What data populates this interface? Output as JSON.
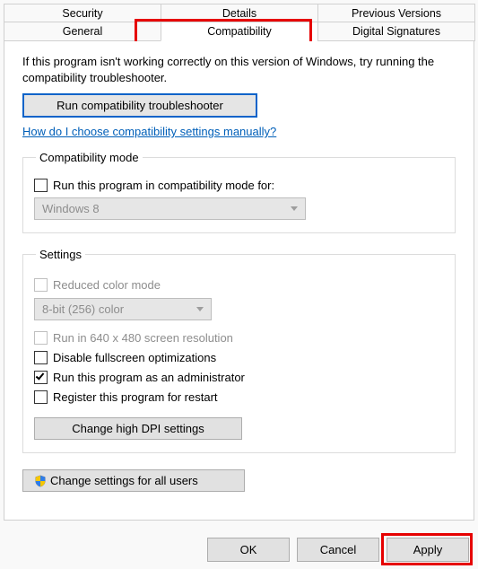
{
  "tabs": {
    "row1": [
      "Security",
      "Details",
      "Previous Versions"
    ],
    "row2": [
      "General",
      "Compatibility",
      "Digital Signatures"
    ],
    "active": "Compatibility"
  },
  "intro": "If this program isn't working correctly on this version of Windows, try running the compatibility troubleshooter.",
  "troubleshooter_btn": "Run compatibility troubleshooter",
  "manual_link": "How do I choose compatibility settings manually?",
  "compat_mode": {
    "legend": "Compatibility mode",
    "checkbox_label": "Run this program in compatibility mode for:",
    "dropdown_value": "Windows 8"
  },
  "settings": {
    "legend": "Settings",
    "reduced_color_label": "Reduced color mode",
    "color_dropdown_value": "8-bit (256) color",
    "run_640_label": "Run in 640 x 480 screen resolution",
    "disable_fullscreen_label": "Disable fullscreen optimizations",
    "run_admin_label": "Run this program as an administrator",
    "register_restart_label": "Register this program for restart",
    "change_dpi_btn": "Change high DPI settings"
  },
  "all_users_btn": "Change settings for all users",
  "buttons": {
    "ok": "OK",
    "cancel": "Cancel",
    "apply": "Apply"
  }
}
